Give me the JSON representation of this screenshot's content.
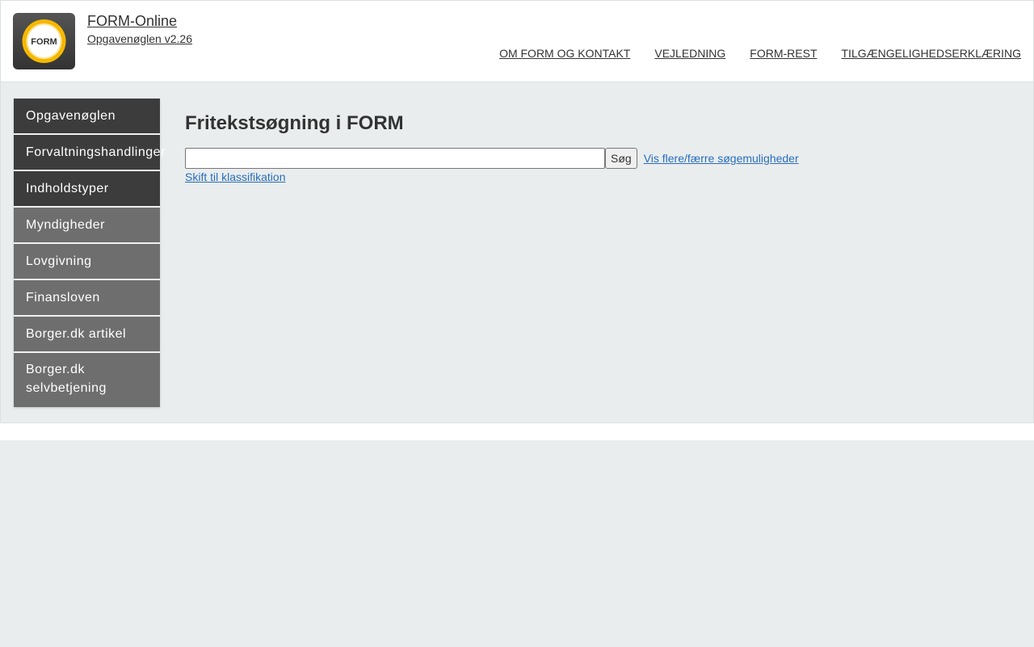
{
  "header": {
    "site_title": "FORM-Online",
    "site_subtitle": "Opgavenøglen v2.26",
    "logo_text": "FORM",
    "logo_icon": "form-logo-icon"
  },
  "topnav": {
    "items": [
      {
        "label": "OM FORM OG KONTAKT"
      },
      {
        "label": "VEJLEDNING"
      },
      {
        "label": "FORM-REST"
      },
      {
        "label": "TILGÆNGELIGHEDSERKLÆRING"
      }
    ]
  },
  "sidebar": {
    "items": [
      {
        "label": "Opgavenøglen"
      },
      {
        "label": "Forvaltningshandlinger"
      },
      {
        "label": "Indholdstyper"
      },
      {
        "label": "Myndigheder"
      },
      {
        "label": "Lovgivning"
      },
      {
        "label": "Finansloven"
      },
      {
        "label": "Borger.dk artikel"
      },
      {
        "label": "Borger.dk selvbetjening"
      }
    ]
  },
  "main": {
    "title": "Fritekstsøgning i FORM",
    "search": {
      "value": "",
      "placeholder": "",
      "button_label": "Søg"
    },
    "toggle_options_link": "Vis flere/færre søgemuligheder",
    "switch_link": "Skift til klassifikation"
  },
  "colors": {
    "sidebar_dark": "#3c3c3c",
    "sidebar_light": "#6e6e6e",
    "link": "#2a6ebb",
    "background": "#e9edee",
    "logo_ring": "#f5b800"
  }
}
